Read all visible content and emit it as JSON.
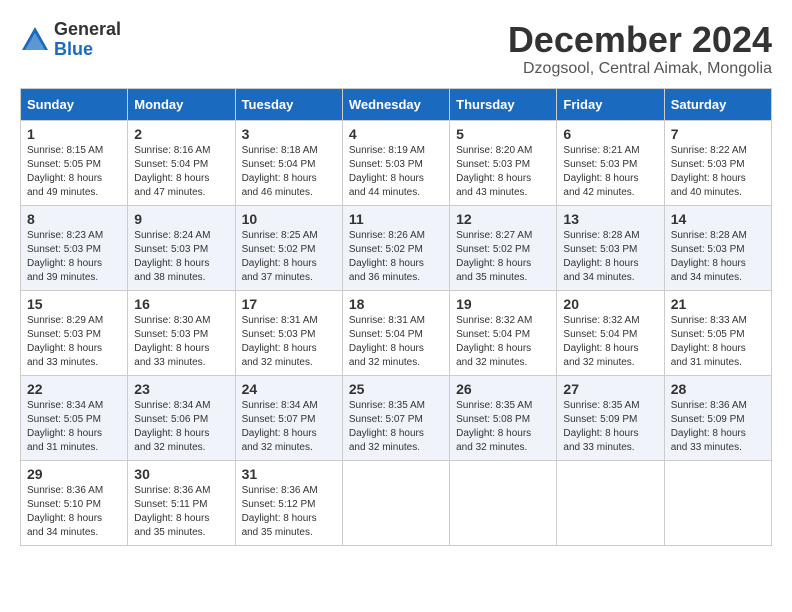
{
  "logo": {
    "general": "General",
    "blue": "Blue"
  },
  "title": "December 2024",
  "location": "Dzogsool, Central Aimak, Mongolia",
  "days_of_week": [
    "Sunday",
    "Monday",
    "Tuesday",
    "Wednesday",
    "Thursday",
    "Friday",
    "Saturday"
  ],
  "weeks": [
    [
      {
        "day": 1,
        "sunrise": "Sunrise: 8:15 AM",
        "sunset": "Sunset: 5:05 PM",
        "daylight": "Daylight: 8 hours and 49 minutes."
      },
      {
        "day": 2,
        "sunrise": "Sunrise: 8:16 AM",
        "sunset": "Sunset: 5:04 PM",
        "daylight": "Daylight: 8 hours and 47 minutes."
      },
      {
        "day": 3,
        "sunrise": "Sunrise: 8:18 AM",
        "sunset": "Sunset: 5:04 PM",
        "daylight": "Daylight: 8 hours and 46 minutes."
      },
      {
        "day": 4,
        "sunrise": "Sunrise: 8:19 AM",
        "sunset": "Sunset: 5:03 PM",
        "daylight": "Daylight: 8 hours and 44 minutes."
      },
      {
        "day": 5,
        "sunrise": "Sunrise: 8:20 AM",
        "sunset": "Sunset: 5:03 PM",
        "daylight": "Daylight: 8 hours and 43 minutes."
      },
      {
        "day": 6,
        "sunrise": "Sunrise: 8:21 AM",
        "sunset": "Sunset: 5:03 PM",
        "daylight": "Daylight: 8 hours and 42 minutes."
      },
      {
        "day": 7,
        "sunrise": "Sunrise: 8:22 AM",
        "sunset": "Sunset: 5:03 PM",
        "daylight": "Daylight: 8 hours and 40 minutes."
      }
    ],
    [
      {
        "day": 8,
        "sunrise": "Sunrise: 8:23 AM",
        "sunset": "Sunset: 5:03 PM",
        "daylight": "Daylight: 8 hours and 39 minutes."
      },
      {
        "day": 9,
        "sunrise": "Sunrise: 8:24 AM",
        "sunset": "Sunset: 5:03 PM",
        "daylight": "Daylight: 8 hours and 38 minutes."
      },
      {
        "day": 10,
        "sunrise": "Sunrise: 8:25 AM",
        "sunset": "Sunset: 5:02 PM",
        "daylight": "Daylight: 8 hours and 37 minutes."
      },
      {
        "day": 11,
        "sunrise": "Sunrise: 8:26 AM",
        "sunset": "Sunset: 5:02 PM",
        "daylight": "Daylight: 8 hours and 36 minutes."
      },
      {
        "day": 12,
        "sunrise": "Sunrise: 8:27 AM",
        "sunset": "Sunset: 5:02 PM",
        "daylight": "Daylight: 8 hours and 35 minutes."
      },
      {
        "day": 13,
        "sunrise": "Sunrise: 8:28 AM",
        "sunset": "Sunset: 5:03 PM",
        "daylight": "Daylight: 8 hours and 34 minutes."
      },
      {
        "day": 14,
        "sunrise": "Sunrise: 8:28 AM",
        "sunset": "Sunset: 5:03 PM",
        "daylight": "Daylight: 8 hours and 34 minutes."
      }
    ],
    [
      {
        "day": 15,
        "sunrise": "Sunrise: 8:29 AM",
        "sunset": "Sunset: 5:03 PM",
        "daylight": "Daylight: 8 hours and 33 minutes."
      },
      {
        "day": 16,
        "sunrise": "Sunrise: 8:30 AM",
        "sunset": "Sunset: 5:03 PM",
        "daylight": "Daylight: 8 hours and 33 minutes."
      },
      {
        "day": 17,
        "sunrise": "Sunrise: 8:31 AM",
        "sunset": "Sunset: 5:03 PM",
        "daylight": "Daylight: 8 hours and 32 minutes."
      },
      {
        "day": 18,
        "sunrise": "Sunrise: 8:31 AM",
        "sunset": "Sunset: 5:04 PM",
        "daylight": "Daylight: 8 hours and 32 minutes."
      },
      {
        "day": 19,
        "sunrise": "Sunrise: 8:32 AM",
        "sunset": "Sunset: 5:04 PM",
        "daylight": "Daylight: 8 hours and 32 minutes."
      },
      {
        "day": 20,
        "sunrise": "Sunrise: 8:32 AM",
        "sunset": "Sunset: 5:04 PM",
        "daylight": "Daylight: 8 hours and 32 minutes."
      },
      {
        "day": 21,
        "sunrise": "Sunrise: 8:33 AM",
        "sunset": "Sunset: 5:05 PM",
        "daylight": "Daylight: 8 hours and 31 minutes."
      }
    ],
    [
      {
        "day": 22,
        "sunrise": "Sunrise: 8:34 AM",
        "sunset": "Sunset: 5:05 PM",
        "daylight": "Daylight: 8 hours and 31 minutes."
      },
      {
        "day": 23,
        "sunrise": "Sunrise: 8:34 AM",
        "sunset": "Sunset: 5:06 PM",
        "daylight": "Daylight: 8 hours and 32 minutes."
      },
      {
        "day": 24,
        "sunrise": "Sunrise: 8:34 AM",
        "sunset": "Sunset: 5:07 PM",
        "daylight": "Daylight: 8 hours and 32 minutes."
      },
      {
        "day": 25,
        "sunrise": "Sunrise: 8:35 AM",
        "sunset": "Sunset: 5:07 PM",
        "daylight": "Daylight: 8 hours and 32 minutes."
      },
      {
        "day": 26,
        "sunrise": "Sunrise: 8:35 AM",
        "sunset": "Sunset: 5:08 PM",
        "daylight": "Daylight: 8 hours and 32 minutes."
      },
      {
        "day": 27,
        "sunrise": "Sunrise: 8:35 AM",
        "sunset": "Sunset: 5:09 PM",
        "daylight": "Daylight: 8 hours and 33 minutes."
      },
      {
        "day": 28,
        "sunrise": "Sunrise: 8:36 AM",
        "sunset": "Sunset: 5:09 PM",
        "daylight": "Daylight: 8 hours and 33 minutes."
      }
    ],
    [
      {
        "day": 29,
        "sunrise": "Sunrise: 8:36 AM",
        "sunset": "Sunset: 5:10 PM",
        "daylight": "Daylight: 8 hours and 34 minutes."
      },
      {
        "day": 30,
        "sunrise": "Sunrise: 8:36 AM",
        "sunset": "Sunset: 5:11 PM",
        "daylight": "Daylight: 8 hours and 35 minutes."
      },
      {
        "day": 31,
        "sunrise": "Sunrise: 8:36 AM",
        "sunset": "Sunset: 5:12 PM",
        "daylight": "Daylight: 8 hours and 35 minutes."
      },
      null,
      null,
      null,
      null
    ]
  ]
}
